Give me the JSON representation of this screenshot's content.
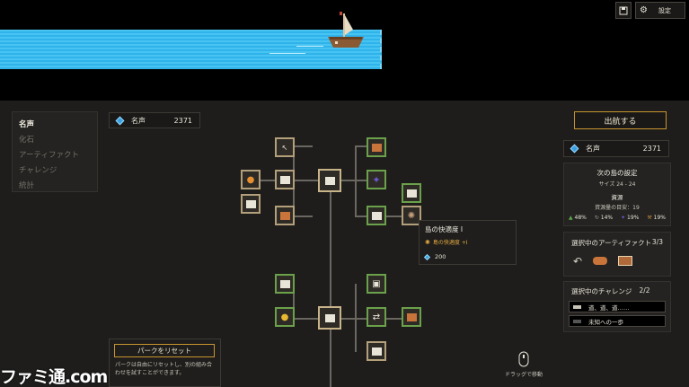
{
  "topbar": {
    "save_icon": "save-icon",
    "settings_icon": "gear-icon",
    "settings_label": "設定"
  },
  "side_menu": {
    "items": [
      "名声",
      "化石",
      "アーティファクト",
      "チャレンジ",
      "統計"
    ]
  },
  "fame_left": {
    "label": "名声",
    "value": "2371"
  },
  "depart_button": "出航する",
  "fame_right": {
    "label": "名声",
    "value": "2371"
  },
  "next_island": {
    "title": "次の島の設定",
    "size": "サイズ 24 - 24",
    "resources_title": "資源",
    "resources_target": "資源量の目安：19",
    "stats": [
      "48%",
      "14%",
      "19%",
      "19%"
    ],
    "stat_colors": [
      "#5aa84a",
      "#a09c94",
      "#6a5ad0",
      "#c08a40"
    ]
  },
  "artifacts": {
    "title": "選択中のアーティファクト",
    "count": "3/3"
  },
  "challenges": {
    "title": "選択中のチャレンジ",
    "count": "2/2",
    "items": [
      "道、道、道……",
      "未知への一歩"
    ]
  },
  "tooltip": {
    "title": "島の快適度 I",
    "effect": "島の快適度 +I",
    "cost": "200"
  },
  "reset": {
    "button": "パークをリセット",
    "desc": "パークは自由にリセットし、別の組み合わせを試すことができます。"
  },
  "drag_hint": "ドラッグで移動",
  "watermark": "ファミ通.com",
  "colors": {
    "sea": "#2fb3ea",
    "accent_gold": "#c8952e",
    "node_green": "#6aa14a"
  }
}
